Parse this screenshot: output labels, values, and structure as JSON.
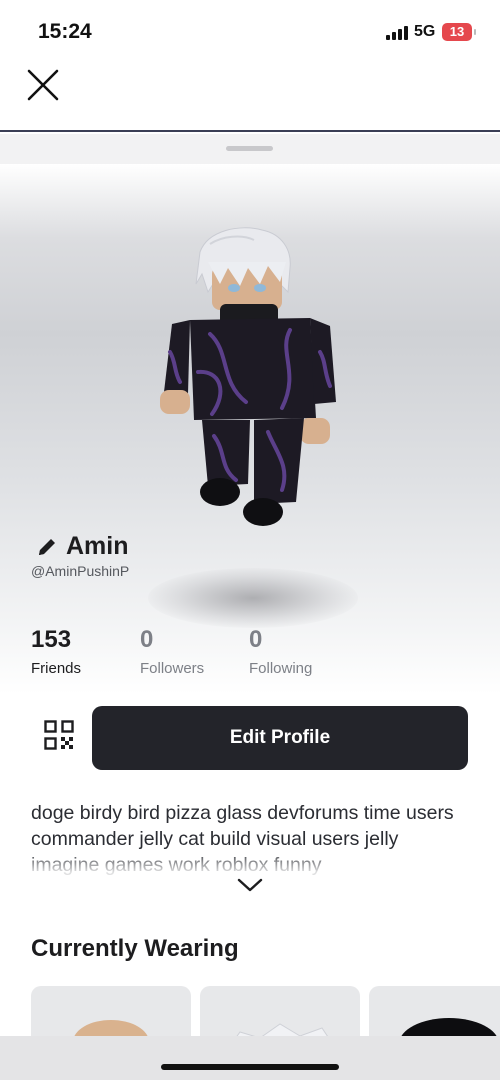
{
  "status_bar": {
    "time": "15:24",
    "network": "5G",
    "battery": "13"
  },
  "top_bar": {
    "close_icon": "close-icon"
  },
  "profile": {
    "display_name": "Amin",
    "username": "@AminPushinP",
    "edit_icon": "pencil-icon"
  },
  "stats": [
    {
      "value": "153",
      "label": "Friends"
    },
    {
      "value": "0",
      "label": "Followers"
    },
    {
      "value": "0",
      "label": "Following"
    }
  ],
  "actions": {
    "qr_icon": "qr-code-icon",
    "edit_profile_label": "Edit Profile"
  },
  "bio": {
    "text": "doge birdy bird pizza glass devforums time users commander jelly cat build visual users jelly imagine games work roblox funny",
    "expand_icon": "chevron-down-icon"
  },
  "currently_wearing": {
    "title": "Currently Wearing",
    "items": [
      "head-item",
      "hair-item",
      "hat-item"
    ]
  },
  "colors": {
    "button_bg": "#23242a",
    "muted_text": "#7d8087",
    "battery_low": "#e5484d"
  }
}
